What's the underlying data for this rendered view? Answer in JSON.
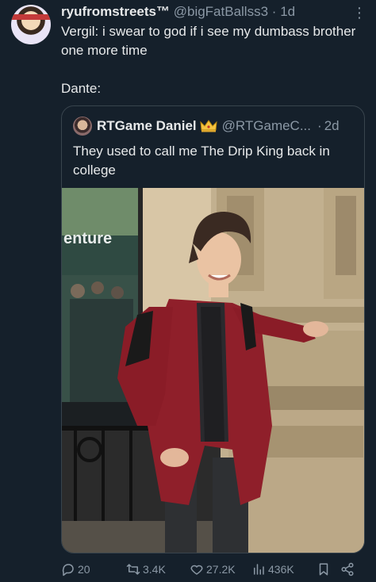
{
  "tweet": {
    "display_name": "ryufromstreets™",
    "handle": "@bigFatBallss3",
    "separator": "·",
    "time": "1d",
    "more_icon": "more-icon",
    "text_line1": "Vergil: i swear to god if i see my dumbass brother one more time",
    "text_line2": "Dante:"
  },
  "quoted": {
    "display_name": "RTGame Daniel",
    "badge_icon": "crown-icon",
    "handle": "@RTGameC...",
    "separator": "·",
    "time": "2d",
    "text": "They used to call me The Drip King back in college",
    "photo_sign_text": "enture"
  },
  "actions": {
    "replies": "20",
    "reposts": "3.4K",
    "likes": "27.2K",
    "views": "436K"
  },
  "colors": {
    "background": "#15202b",
    "text": "#e7e9ea",
    "muted": "#8b98a5",
    "border": "#38444d"
  }
}
